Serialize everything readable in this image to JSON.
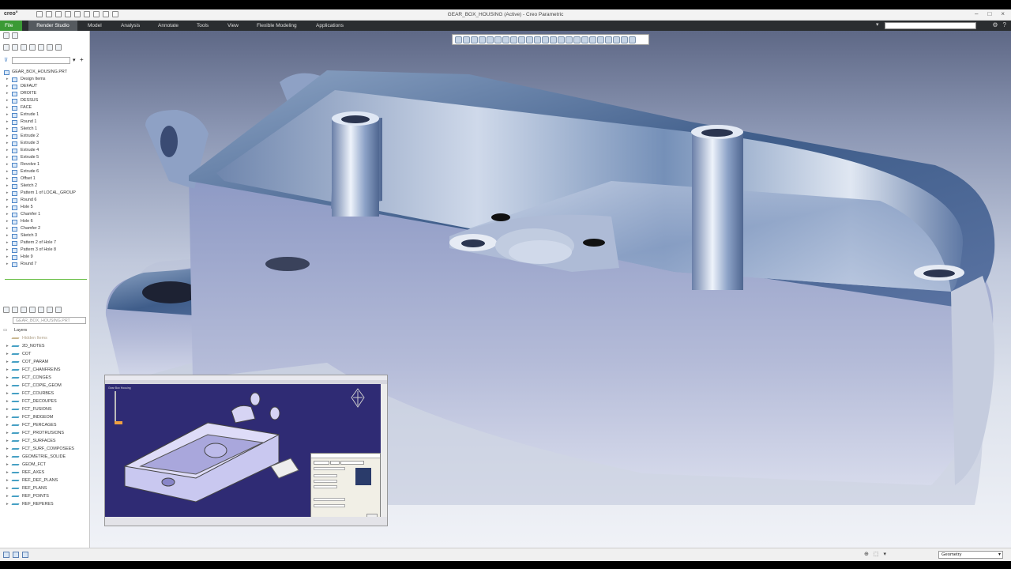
{
  "window": {
    "app_logo": "creo°",
    "title": "GEAR_BOX_HOUSING (Active) - Creo Parametric"
  },
  "ribbon": {
    "tabs": [
      "File",
      "Render Studio",
      "Model",
      "Analysis",
      "Annotate",
      "Tools",
      "View",
      "Flexible Modeling",
      "Applications"
    ],
    "search_value": ""
  },
  "model_tree": {
    "root": "GEAR_BOX_HOUSING.PRT",
    "items": [
      "Design Items",
      "DEFAUT",
      "DROITE",
      "DESSUS",
      "FACE",
      "Extrude 1",
      "Round 1",
      "Sketch 1",
      "Extrude 2",
      "Extrude 3",
      "Extrude 4",
      "Extrude 5",
      "Revolve 1",
      "Extrude 6",
      "Offset 1",
      "Sketch 2",
      "Pattern 1 of LOCAL_GROUP",
      "Round 6",
      "Hole 5",
      "Chamfer 1",
      "Hole 6",
      "Chamfer 2",
      "Sketch 3",
      "Pattern 2 of Hole 7",
      "Pattern 3 of Hole 8",
      "Hole 9",
      "Round 7"
    ]
  },
  "layer_tree": {
    "selector": "GEAR_BOX_HOUSING.PRT",
    "header": "Layers",
    "hidden": "Hidden Items",
    "items": [
      "2D_NOTES",
      "COT",
      "COT_PARAM",
      "FCT_CHANFREINS",
      "FCT_CONGES",
      "FCT_COPIE_GEOM",
      "FCT_COURBES",
      "FCT_DECOUPES",
      "FCT_FUSIONS",
      "FCT_INDGEOM",
      "FCT_PERCAGES",
      "FCT_PROTRUSIONS",
      "FCT_SURFACES",
      "FCT_SURF_COMPOSEES",
      "GEOMETRIE_SOLIDE",
      "GEOM_FCT",
      "REF_AXES",
      "REF_DEF_PLANS",
      "REF_PLANS",
      "REF_POINTS",
      "REF_REPERES"
    ]
  },
  "inset": {
    "tree_root": "Gear Box Housing"
  },
  "status_bar": {
    "filter_value": "Geometry"
  },
  "colors": {
    "ribbon_bg": "#2a2d30",
    "file_tab": "#3b9a35",
    "model_top": "#3d5a86",
    "model_side": "#7c89b3",
    "inset_bg": "#2f2b74"
  }
}
